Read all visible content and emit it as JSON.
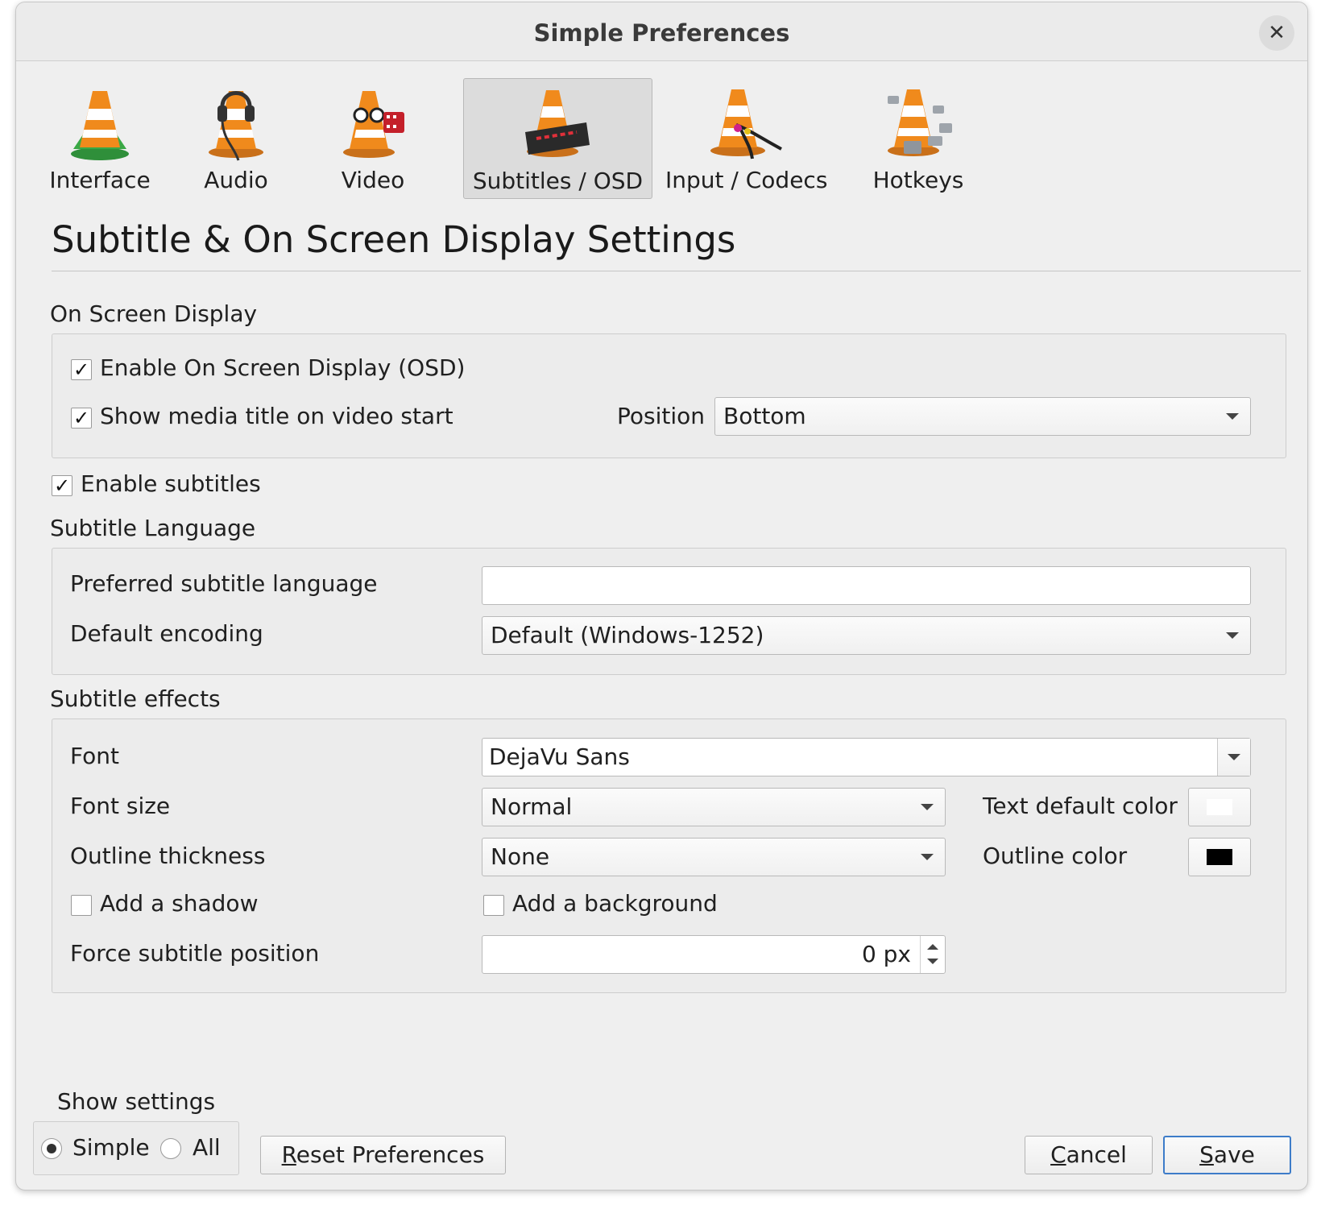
{
  "window": {
    "title": "Simple Preferences",
    "close_glyph": "✕"
  },
  "tabs": [
    {
      "label": "Interface",
      "icon": "vlc-cone-interface-icon",
      "selected": false
    },
    {
      "label": "Audio",
      "icon": "vlc-cone-audio-icon",
      "selected": false
    },
    {
      "label": "Video",
      "icon": "vlc-cone-video-icon",
      "selected": false
    },
    {
      "label": "Subtitles / OSD",
      "icon": "vlc-cone-subtitles-icon",
      "selected": true
    },
    {
      "label": "Input / Codecs",
      "icon": "vlc-cone-input-icon",
      "selected": false
    },
    {
      "label": "Hotkeys",
      "icon": "vlc-cone-hotkeys-icon",
      "selected": false
    }
  ],
  "page_title": "Subtitle & On Screen Display Settings",
  "osd": {
    "section_label": "On Screen Display",
    "enable_osd_label": "Enable On Screen Display (OSD)",
    "enable_osd_checked": true,
    "show_title_label": "Show media title on video start",
    "show_title_checked": true,
    "position_label": "Position",
    "position_value": "Bottom"
  },
  "enable_subtitles": {
    "label": "Enable subtitles",
    "checked": true
  },
  "language": {
    "section_label": "Subtitle Language",
    "preferred_label": "Preferred subtitle language",
    "preferred_value": "",
    "encoding_label": "Default encoding",
    "encoding_value": "Default (Windows-1252)"
  },
  "effects": {
    "section_label": "Subtitle effects",
    "font_label": "Font",
    "font_value": "DejaVu Sans",
    "font_size_label": "Font size",
    "font_size_value": "Normal",
    "text_color_label": "Text default color",
    "text_color": "#ffffff",
    "outline_thickness_label": "Outline thickness",
    "outline_thickness_value": "None",
    "outline_color_label": "Outline color",
    "outline_color": "#000000",
    "shadow_label": "Add a shadow",
    "shadow_checked": false,
    "background_label": "Add a background",
    "background_checked": false,
    "force_position_label": "Force subtitle position",
    "force_position_value": "0 px"
  },
  "footer": {
    "show_settings_label": "Show settings",
    "simple_label": "Simple",
    "all_label": "All",
    "selected_mode": "Simple",
    "reset_mnemonic": "R",
    "reset_rest": "eset Preferences",
    "cancel_mnemonic": "C",
    "cancel_rest": "ancel",
    "save_mnemonic": "S",
    "save_rest": "ave"
  },
  "colors": {
    "window_bg": "#efefef",
    "accent": "#3d7cc9",
    "cone_orange": "#f08a1c"
  }
}
